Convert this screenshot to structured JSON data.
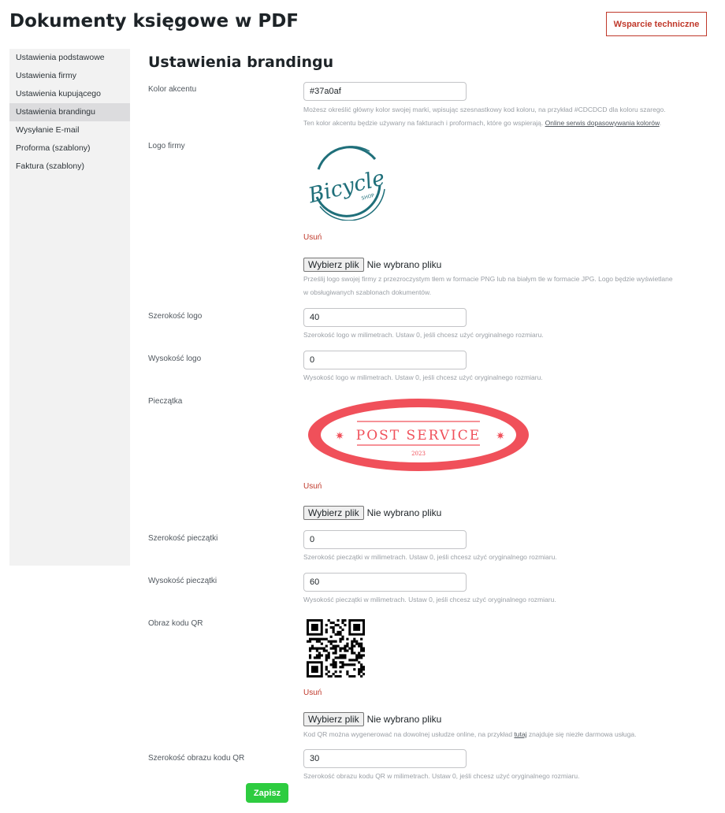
{
  "header": {
    "title": "Dokumenty księgowe w PDF",
    "support_label": "Wsparcie techniczne"
  },
  "sidebar": {
    "items": [
      {
        "label": "Ustawienia podstawowe"
      },
      {
        "label": "Ustawienia firmy"
      },
      {
        "label": "Ustawienia kupującego"
      },
      {
        "label": "Ustawienia brandingu",
        "active": true
      },
      {
        "label": "Wysyłanie E-mail"
      },
      {
        "label": "Proforma (szablony)"
      },
      {
        "label": "Faktura (szablony)"
      }
    ]
  },
  "main": {
    "title": "Ustawienia brandingu",
    "accent": {
      "label": "Kolor akcentu",
      "value": "#37a0af",
      "desc_line1": "Możesz określić główny kolor swojej marki, wpisując szesnastkowy kod koloru, na przykład #CDCDCD dla koloru szarego.",
      "desc_line2": "Ten kolor akcentu będzie używany na fakturach i proformach, które go wspierają. ",
      "desc_link": "Online serwis dopasowywania kolorów",
      "desc_end": "."
    },
    "logo": {
      "label": "Logo firmy",
      "logo_text": "Bicycle",
      "logo_sub": "SHOP",
      "brand_color": "#1f6f7a",
      "remove": "Usuń",
      "file_button": "Wybierz plik",
      "file_status": "Nie wybrano pliku",
      "desc_line1": "Prześlij logo swojej firmy z przezroczystym tłem w formacie PNG lub na białym tle w formacie JPG. Logo będzie wyświetlane",
      "desc_line2": "w obsługiwanych szablonach dokumentów."
    },
    "logo_width": {
      "label": "Szerokość logo",
      "value": "40",
      "desc": "Szerokość logo w milimetrach. Ustaw 0, jeśli chcesz użyć oryginalnego rozmiaru."
    },
    "logo_height": {
      "label": "Wysokość logo",
      "value": "0",
      "desc": "Wysokość logo w milimetrach. Ustaw 0, jeśli chcesz użyć oryginalnego rozmiaru."
    },
    "stamp": {
      "label": "Pieczątka",
      "stamp_text": "POST SERVICE",
      "stamp_year": "2023",
      "stamp_color": "#f0505a",
      "remove": "Usuń",
      "file_button": "Wybierz plik",
      "file_status": "Nie wybrano pliku"
    },
    "stamp_width": {
      "label": "Szerokość pieczątki",
      "value": "0",
      "desc": "Szerokość pieczątki w milimetrach. Ustaw 0, jeśli chcesz użyć oryginalnego rozmiaru."
    },
    "stamp_height": {
      "label": "Wysokość pieczątki",
      "value": "60",
      "desc": "Wysokość pieczątki w milimetrach. Ustaw 0, jeśli chcesz użyć oryginalnego rozmiaru."
    },
    "qr": {
      "label": "Obraz kodu QR",
      "remove": "Usuń",
      "file_button": "Wybierz plik",
      "file_status": "Nie wybrano pliku",
      "desc_pre": "Kod QR można wygenerować na dowolnej usłudze online, na przykład ",
      "desc_link": "tutaj",
      "desc_post": " znajduje się niezłe darmowa usługa."
    },
    "qr_width": {
      "label": "Szerokość obrazu kodu QR",
      "value": "30",
      "desc": "Szerokość obrazu kodu QR w milimetrach. Ustaw 0, jeśli chcesz użyć oryginalnego rozmiaru."
    },
    "save_label": "Zapisz"
  }
}
